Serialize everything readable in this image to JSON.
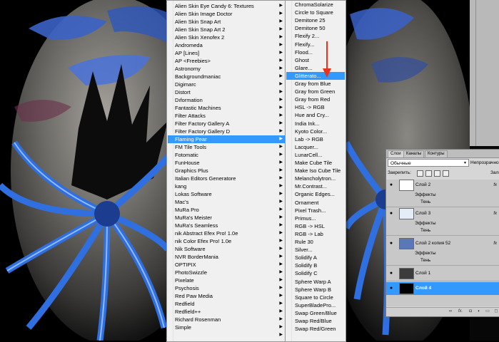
{
  "filters_menu": {
    "items": [
      {
        "label": "Alien Skin Eye Candy 6: Textures",
        "submenu": true
      },
      {
        "label": "Alien Skin Image Doctor",
        "submenu": true
      },
      {
        "label": "Alien Skin Snap Art",
        "submenu": true
      },
      {
        "label": "Alien Skin Snap Art 2",
        "submenu": true
      },
      {
        "label": "Alien Skin Xenofex 2",
        "submenu": true
      },
      {
        "label": "Andromeda",
        "submenu": true
      },
      {
        "label": "AP [Lines]",
        "submenu": true
      },
      {
        "label": "AP <Freebies>",
        "submenu": true
      },
      {
        "label": "Astronomy",
        "submenu": true
      },
      {
        "label": "Backgroundmaniac",
        "submenu": true
      },
      {
        "label": "Digimarc",
        "submenu": true
      },
      {
        "label": "Distort",
        "submenu": true
      },
      {
        "label": "Dıformation",
        "submenu": true
      },
      {
        "label": "Fantastic Machines",
        "submenu": true
      },
      {
        "label": "Filter Attacks",
        "submenu": true
      },
      {
        "label": "Filter Factory Gallery A",
        "submenu": true
      },
      {
        "label": "Filter Factory Gallery D",
        "submenu": true
      },
      {
        "label": "Flaming Pear",
        "submenu": true,
        "highlighted": true
      },
      {
        "label": "FM Tile Tools",
        "submenu": true
      },
      {
        "label": "Fotomatic",
        "submenu": true
      },
      {
        "label": "FunHouse",
        "submenu": true
      },
      {
        "label": "Graphics Plus",
        "submenu": true
      },
      {
        "label": "Italian Editors Generatore",
        "submenu": true
      },
      {
        "label": "kang",
        "submenu": true
      },
      {
        "label": "Lokas Software",
        "submenu": true
      },
      {
        "label": "Mac's",
        "submenu": true
      },
      {
        "label": "MuRa Pro",
        "submenu": true
      },
      {
        "label": "MuRa's Meister",
        "submenu": true
      },
      {
        "label": "MuRa's Seamless",
        "submenu": true
      },
      {
        "label": "nik Abstract Efex Pro! 1.0e",
        "submenu": true
      },
      {
        "label": "nik Color Efex Pro! 1.0e",
        "submenu": true
      },
      {
        "label": "Nik Software",
        "submenu": true
      },
      {
        "label": "NVR BorderMania",
        "submenu": true
      },
      {
        "label": "OPTIPIX",
        "submenu": true
      },
      {
        "label": "PhotoSwizzle",
        "submenu": true
      },
      {
        "label": "Pixelate",
        "submenu": true
      },
      {
        "label": "Psychosis",
        "submenu": true
      },
      {
        "label": "Red Paw Media",
        "submenu": true
      },
      {
        "label": "Redfield",
        "submenu": true
      },
      {
        "label": "Redfield++",
        "submenu": true
      },
      {
        "label": "Richard Rosenman",
        "submenu": true
      },
      {
        "label": "Simple",
        "submenu": true
      },
      {
        "label": "",
        "submenu": true
      }
    ]
  },
  "flaming_pear_menu": {
    "items": [
      {
        "label": "ChromaSolarize"
      },
      {
        "label": "Circle to Square"
      },
      {
        "label": "Demitone 25"
      },
      {
        "label": "Demitone 50"
      },
      {
        "label": "Flexify 2..."
      },
      {
        "label": "Flexify..."
      },
      {
        "label": "Flood..."
      },
      {
        "label": "Ghost"
      },
      {
        "label": "Glare..."
      },
      {
        "label": "Glitterato...",
        "highlighted": true
      },
      {
        "label": "Gray from Blue"
      },
      {
        "label": "Gray from Green"
      },
      {
        "label": "Gray from Red"
      },
      {
        "label": "HSL -> RGB"
      },
      {
        "label": "Hue and Cry..."
      },
      {
        "label": "India Ink..."
      },
      {
        "label": "Kyoto Color..."
      },
      {
        "label": "Lab -> RGB"
      },
      {
        "label": "Lacquer..."
      },
      {
        "label": "LunarCell..."
      },
      {
        "label": "Make Cube Tile"
      },
      {
        "label": "Make Iso Cube Tile"
      },
      {
        "label": "Melancholytron..."
      },
      {
        "label": "Mr.Contrast..."
      },
      {
        "label": "Organic Edges..."
      },
      {
        "label": "Ornament"
      },
      {
        "label": "Pixel Trash..."
      },
      {
        "label": "Primus..."
      },
      {
        "label": "RGB -> HSL"
      },
      {
        "label": "RGB -> Lab"
      },
      {
        "label": "Rule 30"
      },
      {
        "label": "Silver..."
      },
      {
        "label": "Solidify A"
      },
      {
        "label": "Solidify B"
      },
      {
        "label": "Solidify C"
      },
      {
        "label": "Sphere Warp A"
      },
      {
        "label": "Sphere Warp B"
      },
      {
        "label": "Square to Circle"
      },
      {
        "label": "SuperBladePro..."
      },
      {
        "label": "Swap Green/Blue"
      },
      {
        "label": "Swap Red/Blue"
      },
      {
        "label": "Swap Red/Green"
      }
    ]
  },
  "layers_panel": {
    "tabs": [
      "Слои",
      "Каналы",
      "Контуры"
    ],
    "blend_mode": "Обычные",
    "opacity_label": "Непрозрачно",
    "lock_label": "Закрепить:",
    "fill_label": "Зали",
    "layers": [
      {
        "name": "Слой 2",
        "fx": "fx",
        "effects_label": "Эффекты",
        "effect": "Тень"
      },
      {
        "name": "Слой 3",
        "fx": "fx",
        "effects_label": "Эффекты",
        "effect": "Тень"
      },
      {
        "name": "Слой 2 копия 52",
        "fx": "fx",
        "effects_label": "Эффекты",
        "effect": "Тень"
      },
      {
        "name": "Слой 1",
        "fx": "",
        "effects_label": "",
        "effect": ""
      },
      {
        "name": "Слой 4",
        "fx": "",
        "effects_label": "",
        "effect": "",
        "selected": true
      }
    ],
    "footer_fx": "fx."
  },
  "colors": {
    "menu_bg": "#f0f0f0",
    "highlight": "#3399ff",
    "panel_bg": "#d6d6d6",
    "arrow_red": "#e8341c",
    "swirl_blue": "#2f6fe0"
  }
}
